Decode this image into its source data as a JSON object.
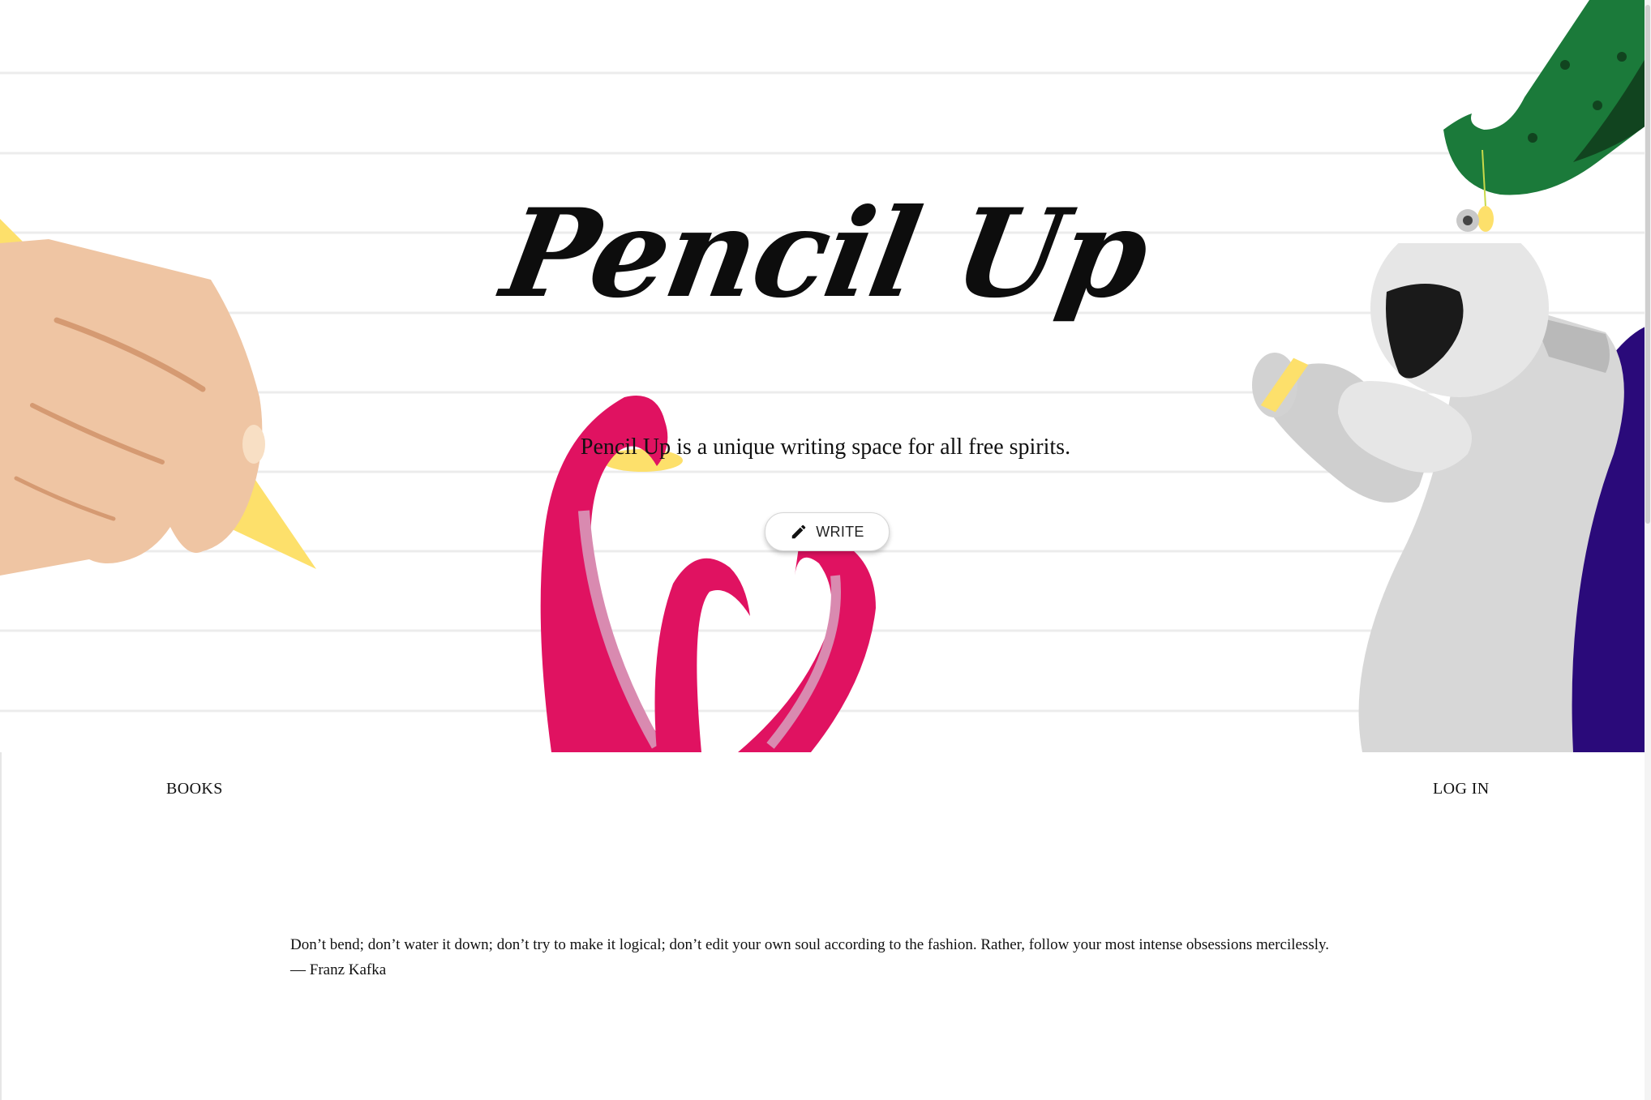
{
  "hero": {
    "title": "Pencil Up",
    "tagline": "Pencil Up is a unique writing space for all free spirits.",
    "write_button": {
      "label": "WRITE",
      "icon": "pencil-icon"
    }
  },
  "nav": {
    "books": "BOOKS",
    "login": "LOG IN"
  },
  "quote": {
    "text": "Don’t bend; don’t water it down; don’t try to make it logical; don’t edit your own soul according to the fashion. Rather, follow your most intense obsessions mercilessly.",
    "author": "— Franz Kafka"
  },
  "colors": {
    "skin": "#efc5a3",
    "pencil": "#fde06b",
    "tentacle": "#e01261",
    "cactus": "#1b7a3a",
    "astronaut": "#d7d7d7",
    "cape": "#2a0a7a"
  }
}
